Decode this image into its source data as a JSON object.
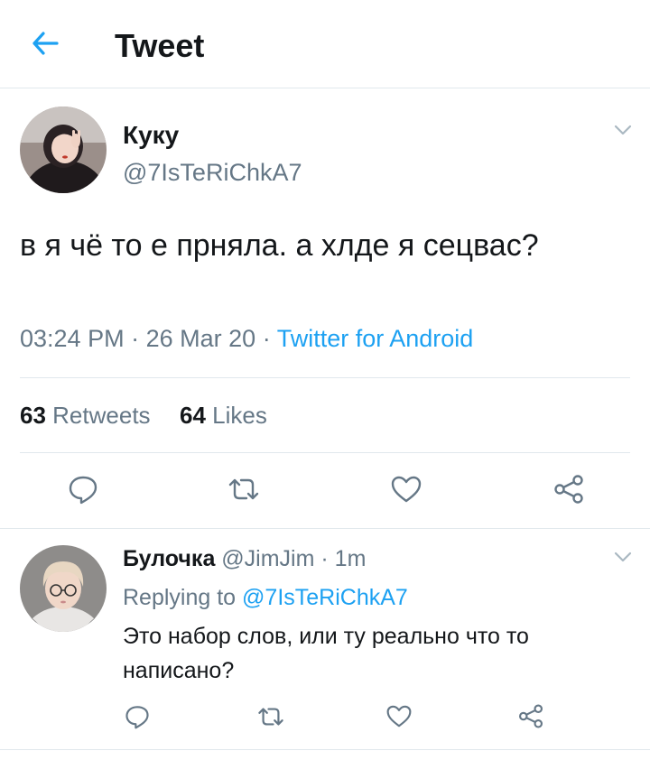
{
  "header": {
    "title": "Tweet",
    "back_icon": "arrow-left-icon",
    "accent": "#1da1f2"
  },
  "tweet": {
    "author_name": "Куку",
    "author_handle": "@7IsTeRiChkA7",
    "text": "в я чё то е прняла. а хлде я сецвас?",
    "time": "03:24 PM",
    "separator": "·",
    "date": "26 Mar 20",
    "source": "Twitter for Android",
    "retweets_count": "63",
    "retweets_label": "Retweets",
    "likes_count": "64",
    "likes_label": "Likes"
  },
  "reply": {
    "author_name": "Булочка",
    "author_handle": "@JimJim",
    "separator": "·",
    "age": "1m",
    "replying_label": "Replying to",
    "replying_to": "@7IsTeRiChkA7",
    "text": "Это набор слов, или ту реально что то написано?"
  },
  "colors": {
    "text": "#14171a",
    "muted": "#657786",
    "divider": "#e1e8ed",
    "link": "#1da1f2"
  }
}
